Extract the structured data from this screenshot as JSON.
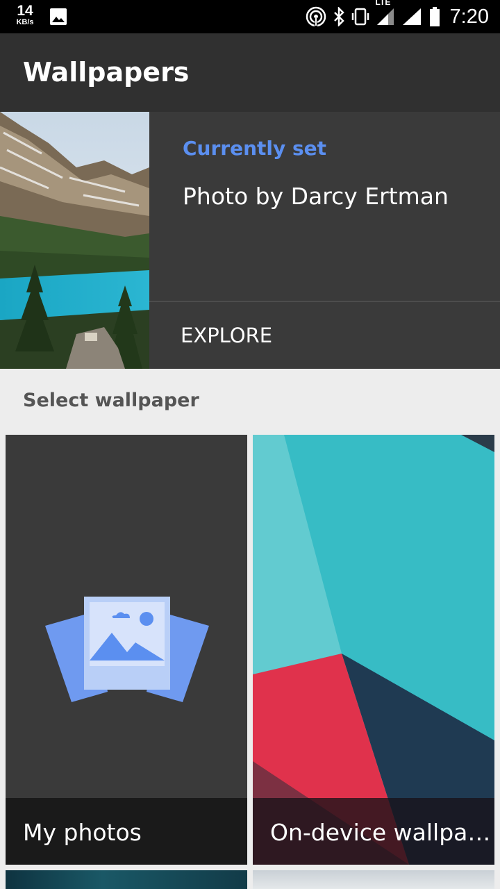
{
  "status_bar": {
    "speed_value": "14",
    "speed_unit": "KB/s",
    "network_label": "LTE",
    "time": "7:20",
    "icons": [
      "gallery-icon",
      "hotspot-icon",
      "bluetooth-icon",
      "vibrate-icon",
      "lte-signal-icon",
      "wifi-signal-icon",
      "battery-icon"
    ]
  },
  "app_bar": {
    "title": "Wallpapers"
  },
  "current": {
    "label": "Currently set",
    "title": "Photo by Darcy Ertman",
    "explore_label": "EXPLORE"
  },
  "section": {
    "label": "Select wallpaper"
  },
  "tiles": [
    {
      "label": "My photos",
      "icon": "photos-icon"
    },
    {
      "label": "On-device wallpa…"
    }
  ],
  "colors": {
    "accent": "#5b8ff0",
    "app_bar": "#303030",
    "card": "#3a3a3a",
    "background": "#ededed"
  }
}
